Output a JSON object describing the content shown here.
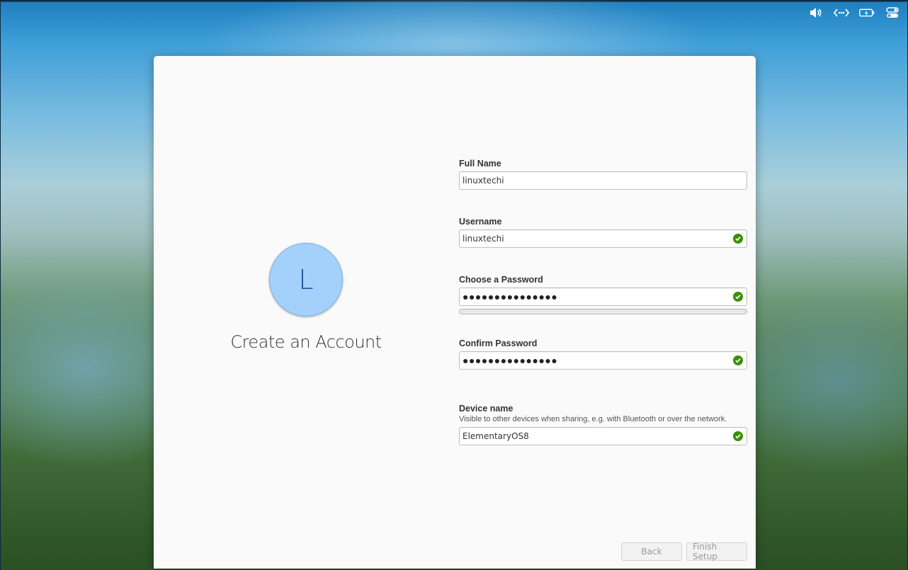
{
  "tray": {
    "icons": [
      "volume-icon",
      "network-icon",
      "battery-icon",
      "quick-settings-icon"
    ]
  },
  "account": {
    "avatar_letter": "L",
    "title": "Create an Account"
  },
  "form": {
    "full_name": {
      "label": "Full Name",
      "value": "linuxtechi"
    },
    "username": {
      "label": "Username",
      "value": "linuxtechi",
      "valid": true
    },
    "password": {
      "label": "Choose a Password",
      "value": "●●●●●●●●●●●●●●●",
      "valid": true,
      "strength": 0
    },
    "confirm": {
      "label": "Confirm Password",
      "value": "●●●●●●●●●●●●●●●",
      "valid": true
    },
    "device": {
      "label": "Device name",
      "description": "Visible to other devices when sharing, e.g. with Bluetooth or over the network.",
      "value": "ElementaryOS8",
      "valid": true
    }
  },
  "buttons": {
    "back": "Back",
    "finish": "Finish Setup"
  },
  "colors": {
    "accent_valid": "#3a9104",
    "avatar_bg": "#a3d1fb",
    "avatar_fg": "#1b4fa0",
    "window_bg": "#fafafa"
  }
}
